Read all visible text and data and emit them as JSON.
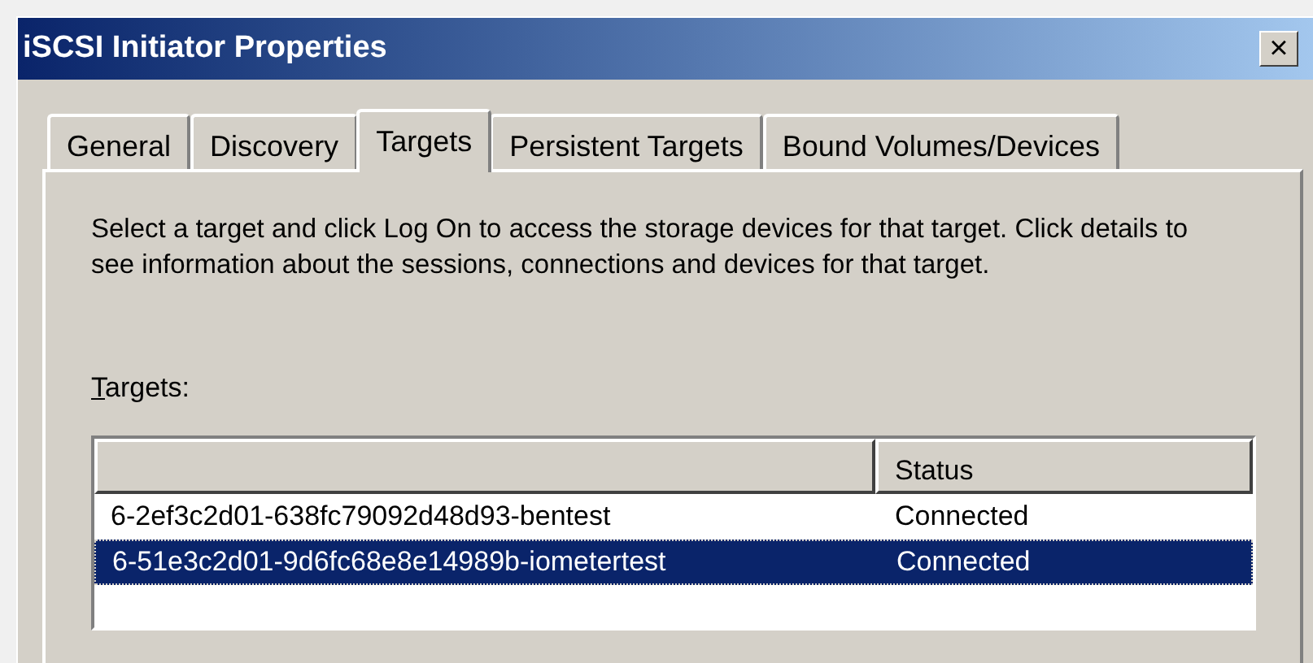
{
  "window": {
    "title": "iSCSI Initiator Properties",
    "close": "×"
  },
  "tabs": [
    {
      "label": "General",
      "selected": false
    },
    {
      "label": "Discovery",
      "selected": false
    },
    {
      "label": "Targets",
      "selected": true
    },
    {
      "label": "Persistent Targets",
      "selected": false
    },
    {
      "label": "Bound Volumes/Devices",
      "selected": false
    }
  ],
  "description": "Select a target and click Log On to access the storage devices for that target. Click details to see information about the sessions, connections and devices for that target.",
  "targets_label": {
    "text": "Targets:"
  },
  "table": {
    "columns": [
      "",
      "Status"
    ],
    "rows": [
      {
        "cells": [
          "6-2ef3c2d01-638fc79092d48d93-bentest",
          "Connected"
        ],
        "selected": false
      },
      {
        "cells": [
          "6-51e3c2d01-9d6fc68e8e14989b-iometertest",
          "Connected"
        ],
        "selected": true
      }
    ]
  }
}
